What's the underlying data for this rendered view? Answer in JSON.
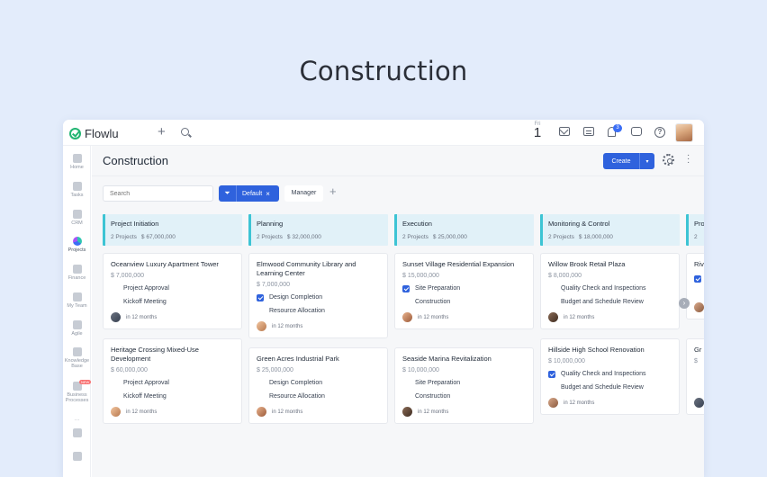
{
  "hero": {
    "title": "Construction"
  },
  "topbar": {
    "logo_text": "Flowlu",
    "date_dow": "Fri",
    "date_day": "1",
    "notif_count": "3"
  },
  "sidebar": {
    "items": [
      {
        "label": "Home",
        "icon": "home-icon"
      },
      {
        "label": "Tasks",
        "icon": "tasks-icon"
      },
      {
        "label": "CRM",
        "icon": "crm-icon"
      },
      {
        "label": "Projects",
        "icon": "projects-icon"
      },
      {
        "label": "Finance",
        "icon": "finance-icon"
      },
      {
        "label": "My Team",
        "icon": "team-icon"
      },
      {
        "label": "Agile",
        "icon": "agile-icon"
      },
      {
        "label": "Knowledge Base",
        "icon": "knowledge-icon"
      },
      {
        "label": "Business Processes",
        "icon": "process-icon",
        "badge": "NEW"
      }
    ]
  },
  "page": {
    "title": "Construction",
    "create_label": "Create",
    "search_placeholder": "Search",
    "filter_chip": "Default",
    "manager_label": "Manager"
  },
  "columns": [
    {
      "title": "Project Initiation",
      "count": "2 Projects",
      "total": "$ 67,000,000",
      "cards": [
        {
          "title": "Oceanview Luxury Apartment Tower",
          "amount": "$ 7,000,000",
          "tasks": [
            {
              "label": "Project Approval",
              "done": false
            },
            {
              "label": "Kickoff Meeting",
              "done": false
            }
          ],
          "due": "in 12 months"
        },
        {
          "title": "Heritage Crossing Mixed-Use Development",
          "amount": "$ 60,000,000",
          "tasks": [
            {
              "label": "Project Approval",
              "done": false
            },
            {
              "label": "Kickoff Meeting",
              "done": false
            }
          ],
          "due": "in 12 months"
        }
      ]
    },
    {
      "title": "Planning",
      "count": "2 Projects",
      "total": "$ 32,000,000",
      "cards": [
        {
          "title": "Elmwood Community Library and Learning Center",
          "amount": "$ 7,000,000",
          "tasks": [
            {
              "label": "Design Completion",
              "done": true
            },
            {
              "label": "Resource Allocation",
              "done": false
            }
          ],
          "due": "in 12 months"
        },
        {
          "title": "Green Acres Industrial Park",
          "amount": "$ 25,000,000",
          "tasks": [
            {
              "label": "Design Completion",
              "done": false
            },
            {
              "label": "Resource Allocation",
              "done": false
            }
          ],
          "due": "in 12 months"
        }
      ]
    },
    {
      "title": "Execution",
      "count": "2 Projects",
      "total": "$ 25,000,000",
      "cards": [
        {
          "title": "Sunset Village Residential Expansion",
          "amount": "$ 15,000,000",
          "tasks": [
            {
              "label": "Site Preparation",
              "done": true
            },
            {
              "label": "Construction",
              "done": false
            }
          ],
          "due": "in 12 months"
        },
        {
          "title": "Seaside Marina Revitalization",
          "amount": "$ 10,000,000",
          "tasks": [
            {
              "label": "Site Preparation",
              "done": false
            },
            {
              "label": "Construction",
              "done": false
            }
          ],
          "due": "in 12 months"
        }
      ]
    },
    {
      "title": "Monitoring & Control",
      "count": "2 Projects",
      "total": "$ 18,000,000",
      "cards": [
        {
          "title": "Willow Brook Retail Plaza",
          "amount": "$ 8,000,000",
          "tasks": [
            {
              "label": "Quality Check and Inspections",
              "done": false
            },
            {
              "label": "Budget and Schedule Review",
              "done": false
            }
          ],
          "due": "in 12 months"
        },
        {
          "title": "Hillside High School Renovation",
          "amount": "$ 10,000,000",
          "tasks": [
            {
              "label": "Quality Check and Inspections",
              "done": true
            },
            {
              "label": "Budget and Schedule Review",
              "done": false
            }
          ],
          "due": "in 12 months"
        }
      ]
    },
    {
      "title": "Pro",
      "count": "2",
      "total": "",
      "cards": [
        {
          "title": "Riv",
          "amount": "",
          "tasks": [
            {
              "label": "",
              "done": true
            },
            {
              "label": "",
              "done": false
            }
          ],
          "due": ""
        },
        {
          "title": "Gr",
          "amount": "$",
          "tasks": [
            {
              "label": "",
              "done": false
            },
            {
              "label": "",
              "done": false
            }
          ],
          "due": ""
        }
      ]
    }
  ],
  "colors": {
    "primary": "#2f62dd",
    "column_accent": "#3dc4d4",
    "column_bg": "#e1f1f8",
    "brand": "#22b573"
  }
}
